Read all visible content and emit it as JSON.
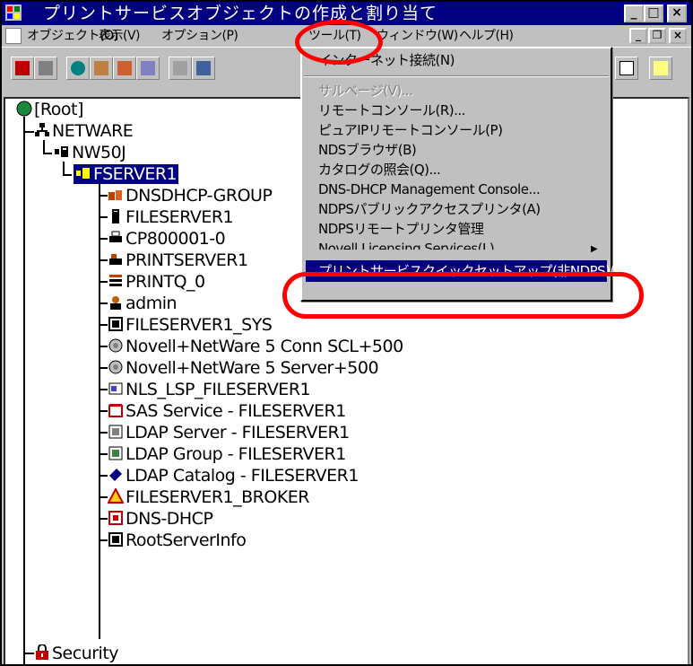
{
  "window": {
    "title": "プリントサービスオブジェクトの作成と割り当て",
    "min_btn": "_",
    "max_btn": "□",
    "close_btn": "×"
  },
  "menubar": {
    "items": [
      "オブジェクト(O)",
      "表示(V)",
      "オプション(P)",
      "ツール(T)",
      "ウィンドウ(W)",
      "ヘルプ(H)"
    ],
    "mdi_min": "_",
    "mdi_restore": "❐",
    "mdi_close": "×"
  },
  "tools_menu": {
    "items": [
      {
        "label": "インターネット接続(N)",
        "disabled": false
      },
      {
        "label": "サルベージ(V)...",
        "disabled": true
      },
      {
        "label": "リモートコンソール(R)...",
        "disabled": false
      },
      {
        "label": "ピュアIPリモートコンソール(P)",
        "disabled": false
      },
      {
        "label": "NDSブラウザ(B)",
        "disabled": false
      },
      {
        "label": "カタログの照会(Q)...",
        "disabled": false
      },
      {
        "label": "DNS-DHCP Management Console...",
        "disabled": false
      },
      {
        "label": "NDPSパブリックアクセスプリンタ(A)",
        "disabled": false
      },
      {
        "label": "NDPSリモートプリンタ管理",
        "disabled": false
      },
      {
        "label": "Novell Licensing Services(L)",
        "disabled": false
      },
      {
        "label": "プリントサービスクイックセットアップ(非NDPS)(Q)",
        "disabled": false,
        "highlighted": true
      }
    ],
    "submenu_arrow": "▶"
  },
  "tree": {
    "root": "[Root]",
    "org": "NETWARE",
    "ou": "NW50J",
    "container": "FSERVER1",
    "children": [
      "DNSDHCP-GROUP",
      "FILESERVER1",
      "CP800001-0",
      "PRINTSERVER1",
      "PRINTQ_0",
      "admin",
      "FILESERVER1_SYS",
      "Novell+NetWare 5 Conn SCL+500",
      "Novell+NetWare 5 Server+500",
      "NLS_LSP_FILESERVER1",
      "SAS Service - FILESERVER1",
      "LDAP Server - FILESERVER1",
      "LDAP Group - FILESERVER1",
      "LDAP Catalog - FILESERVER1",
      "FILESERVER1_BROKER",
      "DNS-DHCP",
      "RootServerInfo"
    ],
    "security": "Security"
  },
  "colors": {
    "title_bar": "#000080",
    "selection": "#000080",
    "annotation_red": "#ff0000",
    "chrome": "#c0c0c0"
  }
}
